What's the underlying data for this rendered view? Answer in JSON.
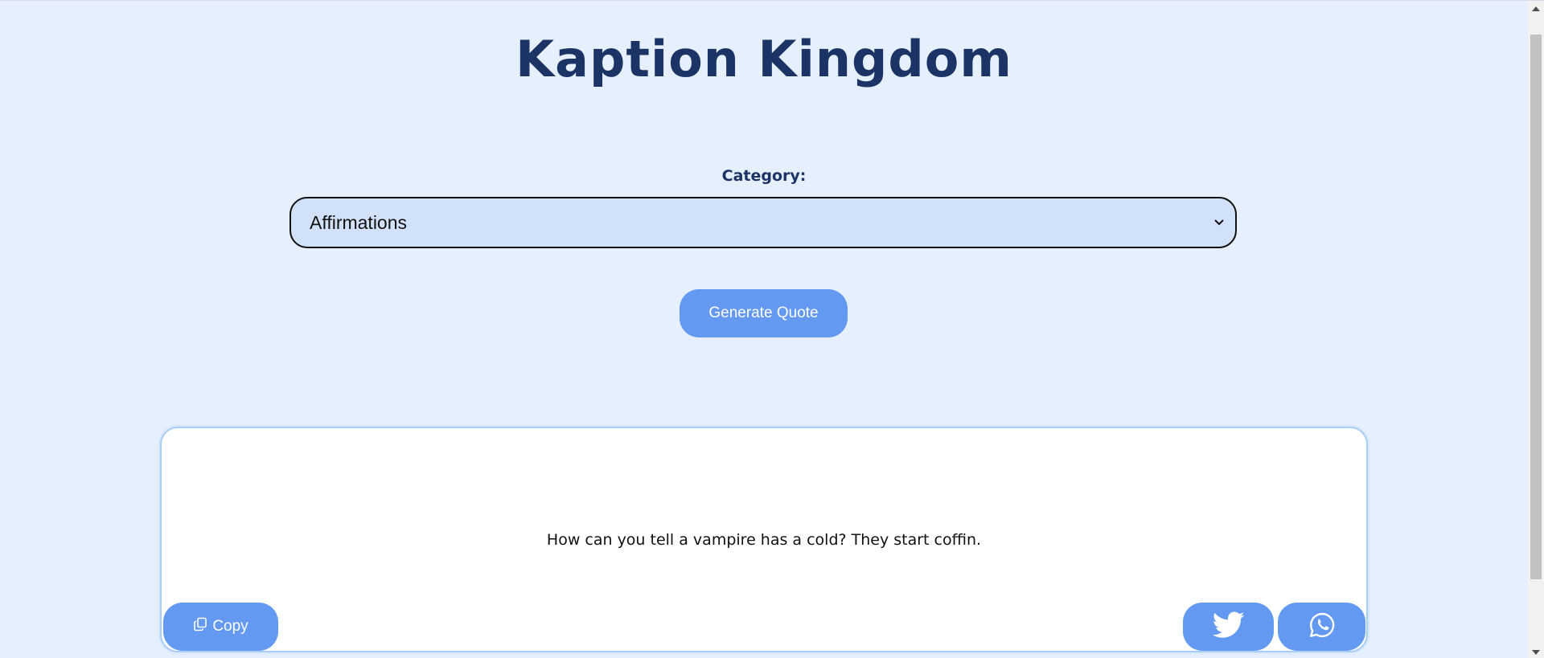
{
  "header": {
    "title": "Kaption Kingdom"
  },
  "form": {
    "category_label": "Category:",
    "category_selected": "Affirmations",
    "generate_label": "Generate Quote"
  },
  "quote": {
    "text": "How can you tell a vampire has a cold? They start coffin.",
    "copy_label": "Copy"
  },
  "icons": {
    "copy": "copy-icon",
    "chevron": "chevron-down-icon",
    "twitter": "twitter-icon",
    "whatsapp": "whatsapp-icon"
  },
  "colors": {
    "background": "#e6f0fd",
    "title": "#1c3366",
    "button": "#6499f2",
    "select_bg": "#d2e1fa",
    "card_border": "#a8cdf6"
  }
}
